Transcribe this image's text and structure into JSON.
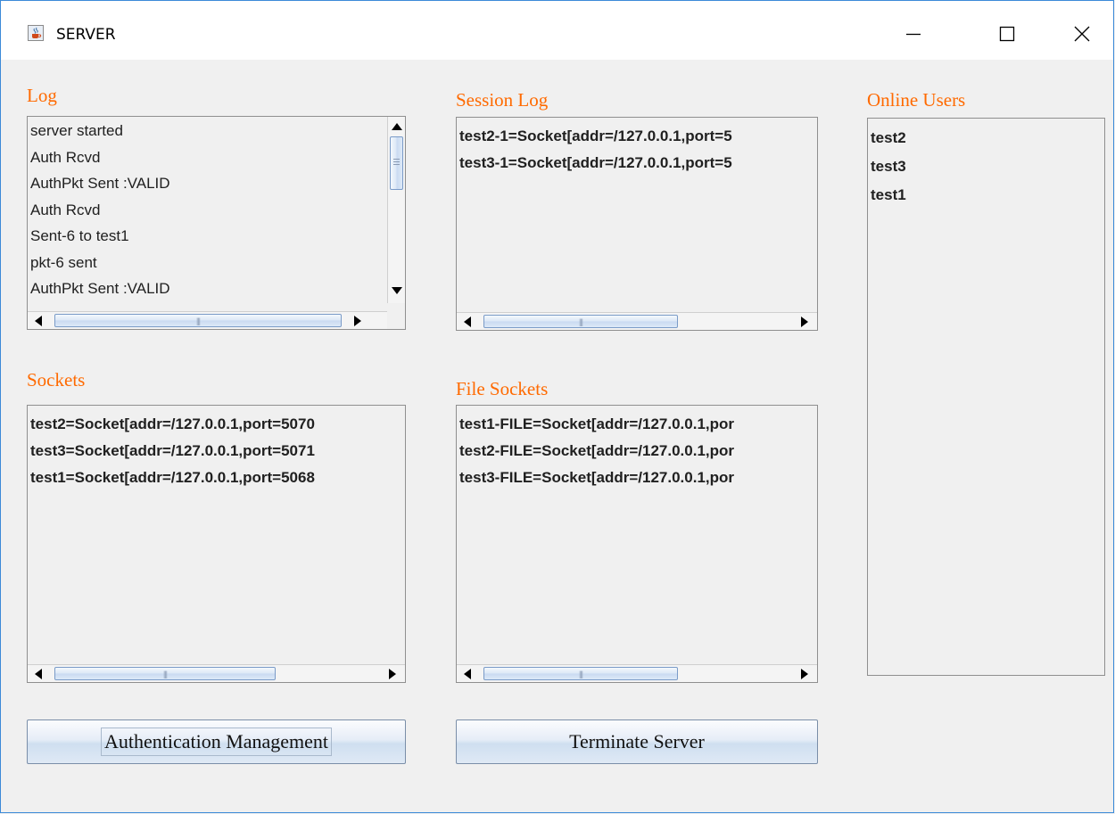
{
  "window": {
    "title": "SERVER",
    "app_icon": "java-cup-icon",
    "controls": [
      "minimize-icon",
      "maximize-icon",
      "close-icon"
    ]
  },
  "log": {
    "label": "Log",
    "items": [
      "server started",
      "Auth Rcvd",
      "AuthPkt Sent :VALID",
      "Auth Rcvd",
      "Sent-6 to test1",
      "pkt-6  sent",
      "AuthPkt Sent :VALID"
    ]
  },
  "session_log": {
    "label": "Session Log",
    "items": [
      "test2-1=Socket[addr=/127.0.0.1,port=5",
      "test3-1=Socket[addr=/127.0.0.1,port=5"
    ]
  },
  "online_users": {
    "label": "Online Users",
    "items": [
      "test2",
      "test3",
      "test1"
    ]
  },
  "sockets": {
    "label": "Sockets",
    "items": [
      "test2=Socket[addr=/127.0.0.1,port=5070",
      "test3=Socket[addr=/127.0.0.1,port=5071",
      "test1=Socket[addr=/127.0.0.1,port=5068"
    ]
  },
  "file_sockets": {
    "label": "File Sockets",
    "items": [
      "test1-FILE=Socket[addr=/127.0.0.1,por",
      "test2-FILE=Socket[addr=/127.0.0.1,por",
      "test3-FILE=Socket[addr=/127.0.0.1,por"
    ]
  },
  "buttons": {
    "auth_management": "Authentication Management",
    "terminate": "Terminate Server"
  },
  "colors": {
    "section_label": "#ff6a00",
    "window_border": "#3c8ad8",
    "background": "#f0f0f0"
  }
}
